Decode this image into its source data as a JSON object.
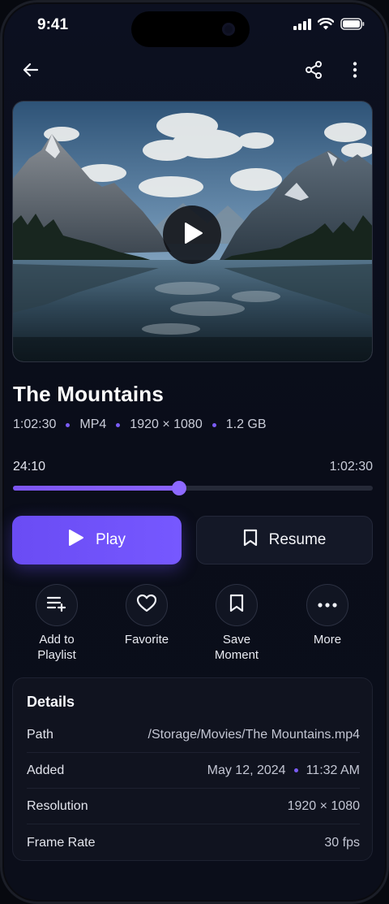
{
  "status": {
    "time": "9:41",
    "icons": [
      "cellular-signal-icon",
      "wifi-icon",
      "battery-icon"
    ]
  },
  "nav": {
    "back_icon": "arrow-left-icon",
    "share_icon": "share-icon",
    "menu_icon": "more-vertical-icon"
  },
  "media": {
    "thumbnail": "mountain-lake-landscape",
    "overlay_icon": "play-icon"
  },
  "video": {
    "title": "The Mountains",
    "meta": {
      "duration": "1:02:30",
      "format": "MP4",
      "resolution": "1920 × 1080",
      "size": "1.2 GB"
    }
  },
  "playback": {
    "current": "24:10",
    "total": "1:02:30",
    "progress": 0.4627
  },
  "buttons": {
    "play_label": "Play",
    "resume_label": "Resume"
  },
  "actions": [
    {
      "label_line1": "Add to",
      "label_line2": "Playlist",
      "icon": "playlist-add-icon"
    },
    {
      "label_line1": "Favorite",
      "label_line2": "",
      "icon": "heart-icon"
    },
    {
      "label_line1": "Save",
      "label_line2": "Moment",
      "icon": "bookmark-icon"
    },
    {
      "label_line1": "More",
      "label_line2": "",
      "icon": "more-horizontal-icon"
    }
  ],
  "details": {
    "title": "Details",
    "rows": [
      {
        "key": "Path",
        "value": "/Storage/Movies/The Mountains.mp4"
      },
      {
        "key": "Added",
        "value_date": "May 12, 2024",
        "value_time": "11:32 AM"
      },
      {
        "key": "Resolution",
        "value": "1920 × 1080"
      },
      {
        "key": "Frame Rate",
        "value": "30 fps"
      }
    ]
  },
  "colors": {
    "accent": "#7658ff",
    "background": "#0a0d19",
    "card": "#10131f"
  }
}
